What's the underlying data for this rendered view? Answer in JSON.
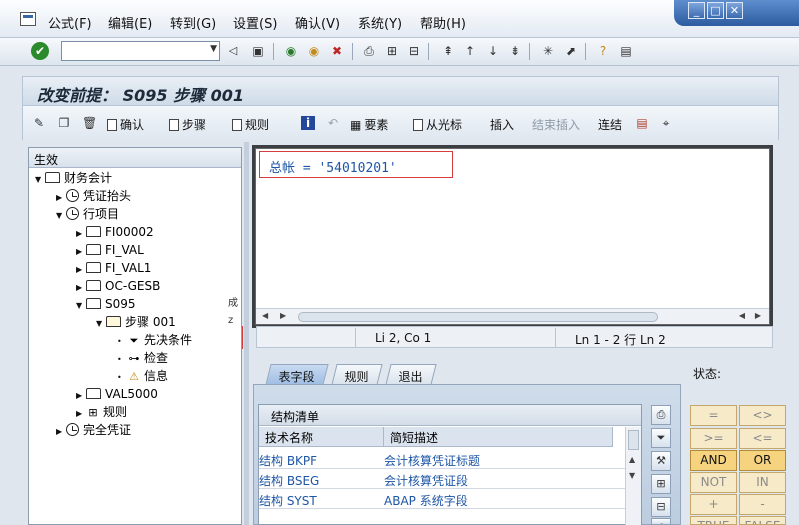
{
  "menubar": {
    "items": [
      "公式(F)",
      "编辑(E)",
      "转到(G)",
      "设置(S)",
      "确认(V)",
      "系统(Y)",
      "帮助(H)"
    ]
  },
  "window_controls": [
    "minimize",
    "maximize",
    "close"
  ],
  "command_field": {
    "value": ""
  },
  "title": "改变前提： S095 步骤 001",
  "app_toolbar": {
    "btn_confirm": "确认",
    "btn_step": "步骤",
    "btn_rule": "规则",
    "btn_element": "要素",
    "btn_from_cursor": "从光标",
    "btn_insert": "插入",
    "btn_end_insert": "结束插入",
    "btn_link": "连结"
  },
  "tree": {
    "header": "生效",
    "nodes": [
      {
        "label": "财务会计",
        "icon": "folder-icon",
        "toggle": "open"
      },
      {
        "label": "凭证抬头",
        "icon": "clock-icon",
        "toggle": "closed"
      },
      {
        "label": "行项目",
        "icon": "clock-icon",
        "toggle": "open"
      },
      {
        "label": "FI00002",
        "icon": "folder-icon",
        "toggle": "closed"
      },
      {
        "label": "FI_VAL",
        "icon": "folder-icon",
        "toggle": "closed"
      },
      {
        "label": "FI_VAL1",
        "icon": "folder-icon",
        "toggle": "closed"
      },
      {
        "label": "OC-GESB",
        "icon": "folder-icon",
        "toggle": "closed"
      },
      {
        "label": "S095",
        "icon": "folder-icon",
        "toggle": "open"
      },
      {
        "label": "步骤 001",
        "icon": "open-folder-icon",
        "toggle": "open"
      },
      {
        "label": "先决条件",
        "icon": "filter-icon",
        "toggle": "leaf"
      },
      {
        "label": "检查",
        "icon": "check-tree-icon",
        "toggle": "leaf"
      },
      {
        "label": "信息",
        "icon": "bell-icon",
        "toggle": "leaf"
      },
      {
        "label": "VAL5000",
        "icon": "folder-icon",
        "toggle": "closed"
      },
      {
        "label": "规则",
        "icon": "rule-icon",
        "toggle": "closed"
      },
      {
        "label": "完全凭证",
        "icon": "clock-icon",
        "toggle": "closed"
      }
    ],
    "side_strip": [
      "成",
      "z"
    ]
  },
  "editor": {
    "condition": "总帐 = '54010201'"
  },
  "statusbar": {
    "cursor": "Li 2, Co 1",
    "lines": "Ln 1 - 2 行 Ln 2"
  },
  "tabs": [
    "表字段",
    "规则",
    "退出"
  ],
  "structure_list": {
    "title": "结构清单",
    "columns": [
      "技术名称",
      "简短描述"
    ],
    "rows": [
      {
        "name": "结构 BKPF",
        "desc": "会计核算凭证标题"
      },
      {
        "name": "结构 BSEG",
        "desc": "会计核算凭证段"
      },
      {
        "name": "结构 SYST",
        "desc": "ABAP 系统字段"
      }
    ]
  },
  "status_label": "状态:",
  "operators": {
    "eq": "=",
    "ne": "<>",
    "ge": ">=",
    "le": "<=",
    "and": "AND",
    "or": "OR",
    "not": "NOT",
    "in": "IN",
    "plus": "+",
    "minus": "-",
    "true": "TRUE",
    "false": "FALSE"
  }
}
